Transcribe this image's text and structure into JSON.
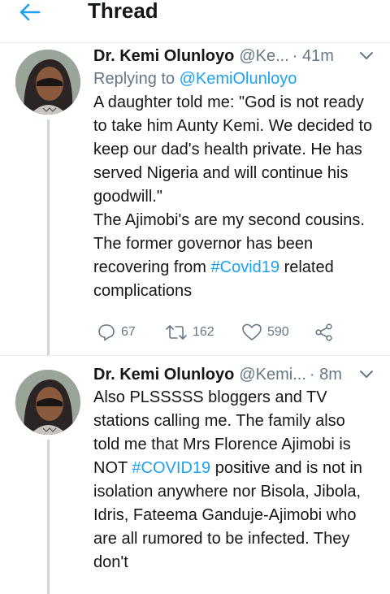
{
  "header": {
    "title": "Thread",
    "back_icon": "arrow-left-icon"
  },
  "tweets": [
    {
      "name": "Dr. Kemi Olunloyo",
      "handle": "@Ke...",
      "time": "· 41m",
      "reply_prefix": "Replying to",
      "reply_handle": "@KemiOlunloyo",
      "text_a": "A daughter told me: \"God is not ready to take him Aunty Kemi. We decided to keep our dad's health private. He has served Nigeria and will continue his goodwill.\"",
      "text_b": "The Ajimobi's are my second cousins. The former governor has been recovering from ",
      "hashtag": "#Covid19",
      "text_c": " related complications",
      "replies": "67",
      "retweets": "162",
      "likes": "590"
    },
    {
      "name": "Dr. Kemi Olunloyo",
      "handle": "@Kemi...",
      "time": "· 8m",
      "text_a": "Also PLSSSSS bloggers and TV stations calling me. The family also told me that Mrs Florence Ajimobi is NOT ",
      "hashtag": "#COVID19",
      "text_b": " positive and is not in isolation anywhere nor Bisola, Jibola, Idris, Fateema Ganduje-Ajimobi who are all rumored to be infected. They don't"
    }
  ],
  "colors": {
    "accent": "#1da1f2",
    "muted": "#657786",
    "text": "#14171a",
    "divider": "#e6ecf0"
  }
}
